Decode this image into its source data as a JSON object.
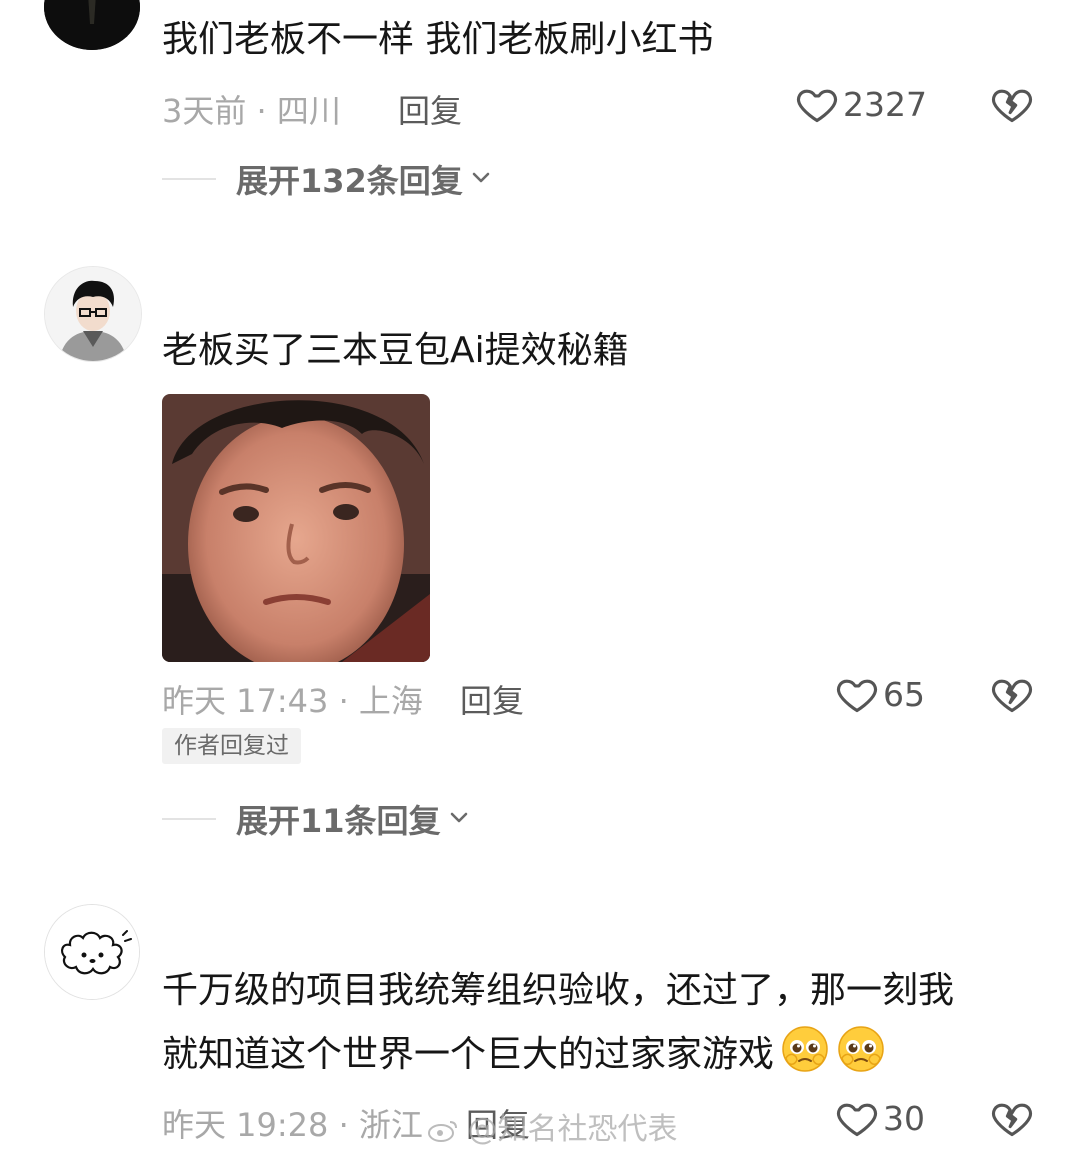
{
  "comments": [
    {
      "text": "我们老板不一样  我们老板刷小红书",
      "meta": "3天前 · 四川",
      "reply_label": "回复",
      "likes": "2327",
      "expand_label": "展开132条回复"
    },
    {
      "text": "老板买了三本豆包Ai提效秘籍",
      "meta": "昨天 17:43 · 上海",
      "reply_label": "回复",
      "likes": "65",
      "badge": "作者回复过",
      "expand_label": "展开11条回复"
    },
    {
      "text_line1": "千万级的项目我统筹组织验收，还过了，那一刻我",
      "text_line2": "就知道这个世界一个巨大的过家家游戏",
      "meta": "昨天 19:28 · 浙江",
      "reply_label": "回复",
      "likes": "30"
    }
  ],
  "watermark": "@知名社恐代表",
  "icons": {
    "like": "heart-outline-icon",
    "dislike": "broken-heart-icon",
    "expand": "chevron-down-icon",
    "emoji": "pleading-face-emoji",
    "watermark": "weibo-logo-icon"
  },
  "colors": {
    "text": "#161616",
    "meta": "#a8a8a8",
    "reply": "#5b5b5b",
    "badge_bg": "#f1f1f1"
  }
}
